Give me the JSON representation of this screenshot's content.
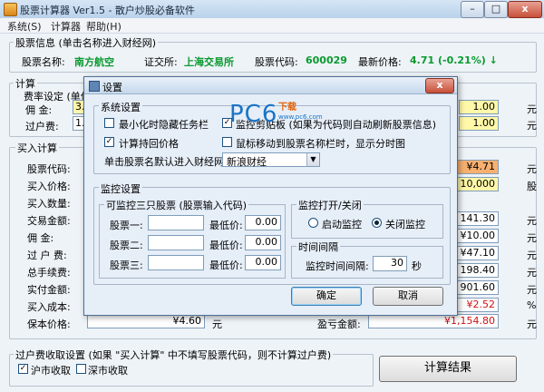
{
  "window": {
    "title": "股票计算器 Ver1.5 - 散户炒股必备软件",
    "min_label": "–",
    "max_label": "□",
    "close_label": "x"
  },
  "menu": [
    "系统(S)",
    "计算器",
    "帮助(H)"
  ],
  "stock_info": {
    "legend": "股票信息 (单击名称进入财经网)",
    "name_label": "股票名称:",
    "name_value": "南方航空",
    "exchange_label": "证交所:",
    "exchange_value": "上海交易所",
    "code_label": "股票代码:",
    "code_value": "600029",
    "price_label": "最新价格:",
    "price_value": "4.71 (-0.21%) ↓"
  },
  "calc": {
    "legend": "计算",
    "fee_legend": "费率设定 (单位",
    "commission_label": "佣 金:",
    "commission_value": "3.",
    "transfer_label": "过户费:",
    "transfer_value": "1.",
    "right_value_1": "1.00",
    "right_value_2": "1.00",
    "unit_yuan": "元"
  },
  "buy_calc": {
    "legend": "买入计算",
    "labels": [
      "股票代码:",
      "买入价格:",
      "买入数量:",
      "交易金额:",
      "佣 金:",
      "过 户 费:",
      "总手续费:",
      "实付金额:",
      "买入成本:"
    ],
    "right_values": [
      "¥4.71",
      "10,000",
      "141.30",
      "¥10.00",
      "¥47.10",
      "198.40",
      "901.60",
      "¥2.52",
      "¥1,154.80"
    ],
    "right_units": [
      "元",
      "股",
      "元",
      "元",
      "元",
      "元",
      "元",
      "%",
      "元"
    ],
    "breakeven_label": "保本价格:",
    "breakeven_value": "¥4.60",
    "breakeven_unit": "元",
    "profit_label": "盈亏金额:"
  },
  "transfer_settings": {
    "legend": "过户费收取设置 (如果 \"买入计算\" 中不填写股票代码，则不计算过户费)",
    "sh_label": "沪市收取",
    "sh_checked": "✓",
    "sz_label": "深市收取"
  },
  "calc_button": "计算结果",
  "dialog": {
    "title": "设置",
    "system_legend": "系统设置",
    "minimize_tray": "最小化时隐藏任务栏",
    "monitor_clipboard": "监控剪贴板 (如果为代码则自动刷新股票信息)",
    "monitor_checked": "✓",
    "calc_restore": "计算持回价格",
    "calc_checked": "✓",
    "mouse_hover": "鼠标移动到股票名称栏时，显示分时图",
    "default_site_label": "单击股票名默认进入财经网:",
    "default_site_value": "新浪财经",
    "monitor_legend": "监控设置",
    "three_stocks_legend": "可监控三只股票 (股票输入代码)",
    "stock1": "股票一:",
    "stock2": "股票二:",
    "stock3": "股票三:",
    "min_price": "最低价:",
    "min_values": [
      "0.00",
      "0.00",
      "0.00"
    ],
    "switch_legend": "监控打开/关闭",
    "start_label": "启动监控",
    "stop_label": "关闭监控",
    "interval_legend": "时间间隔",
    "interval_label": "监控时间间隔:",
    "interval_value": "30",
    "interval_unit": "秒",
    "ok_label": "确定",
    "cancel_label": "取消"
  },
  "watermark": {
    "main": "PC6",
    "small": "下载",
    "sub": "www.pc6.com"
  },
  "colors": {
    "green": "#0A9A2E",
    "red": "#D01010",
    "yellow_field": "#FFF8A8",
    "orange_field": "#F8B070"
  }
}
